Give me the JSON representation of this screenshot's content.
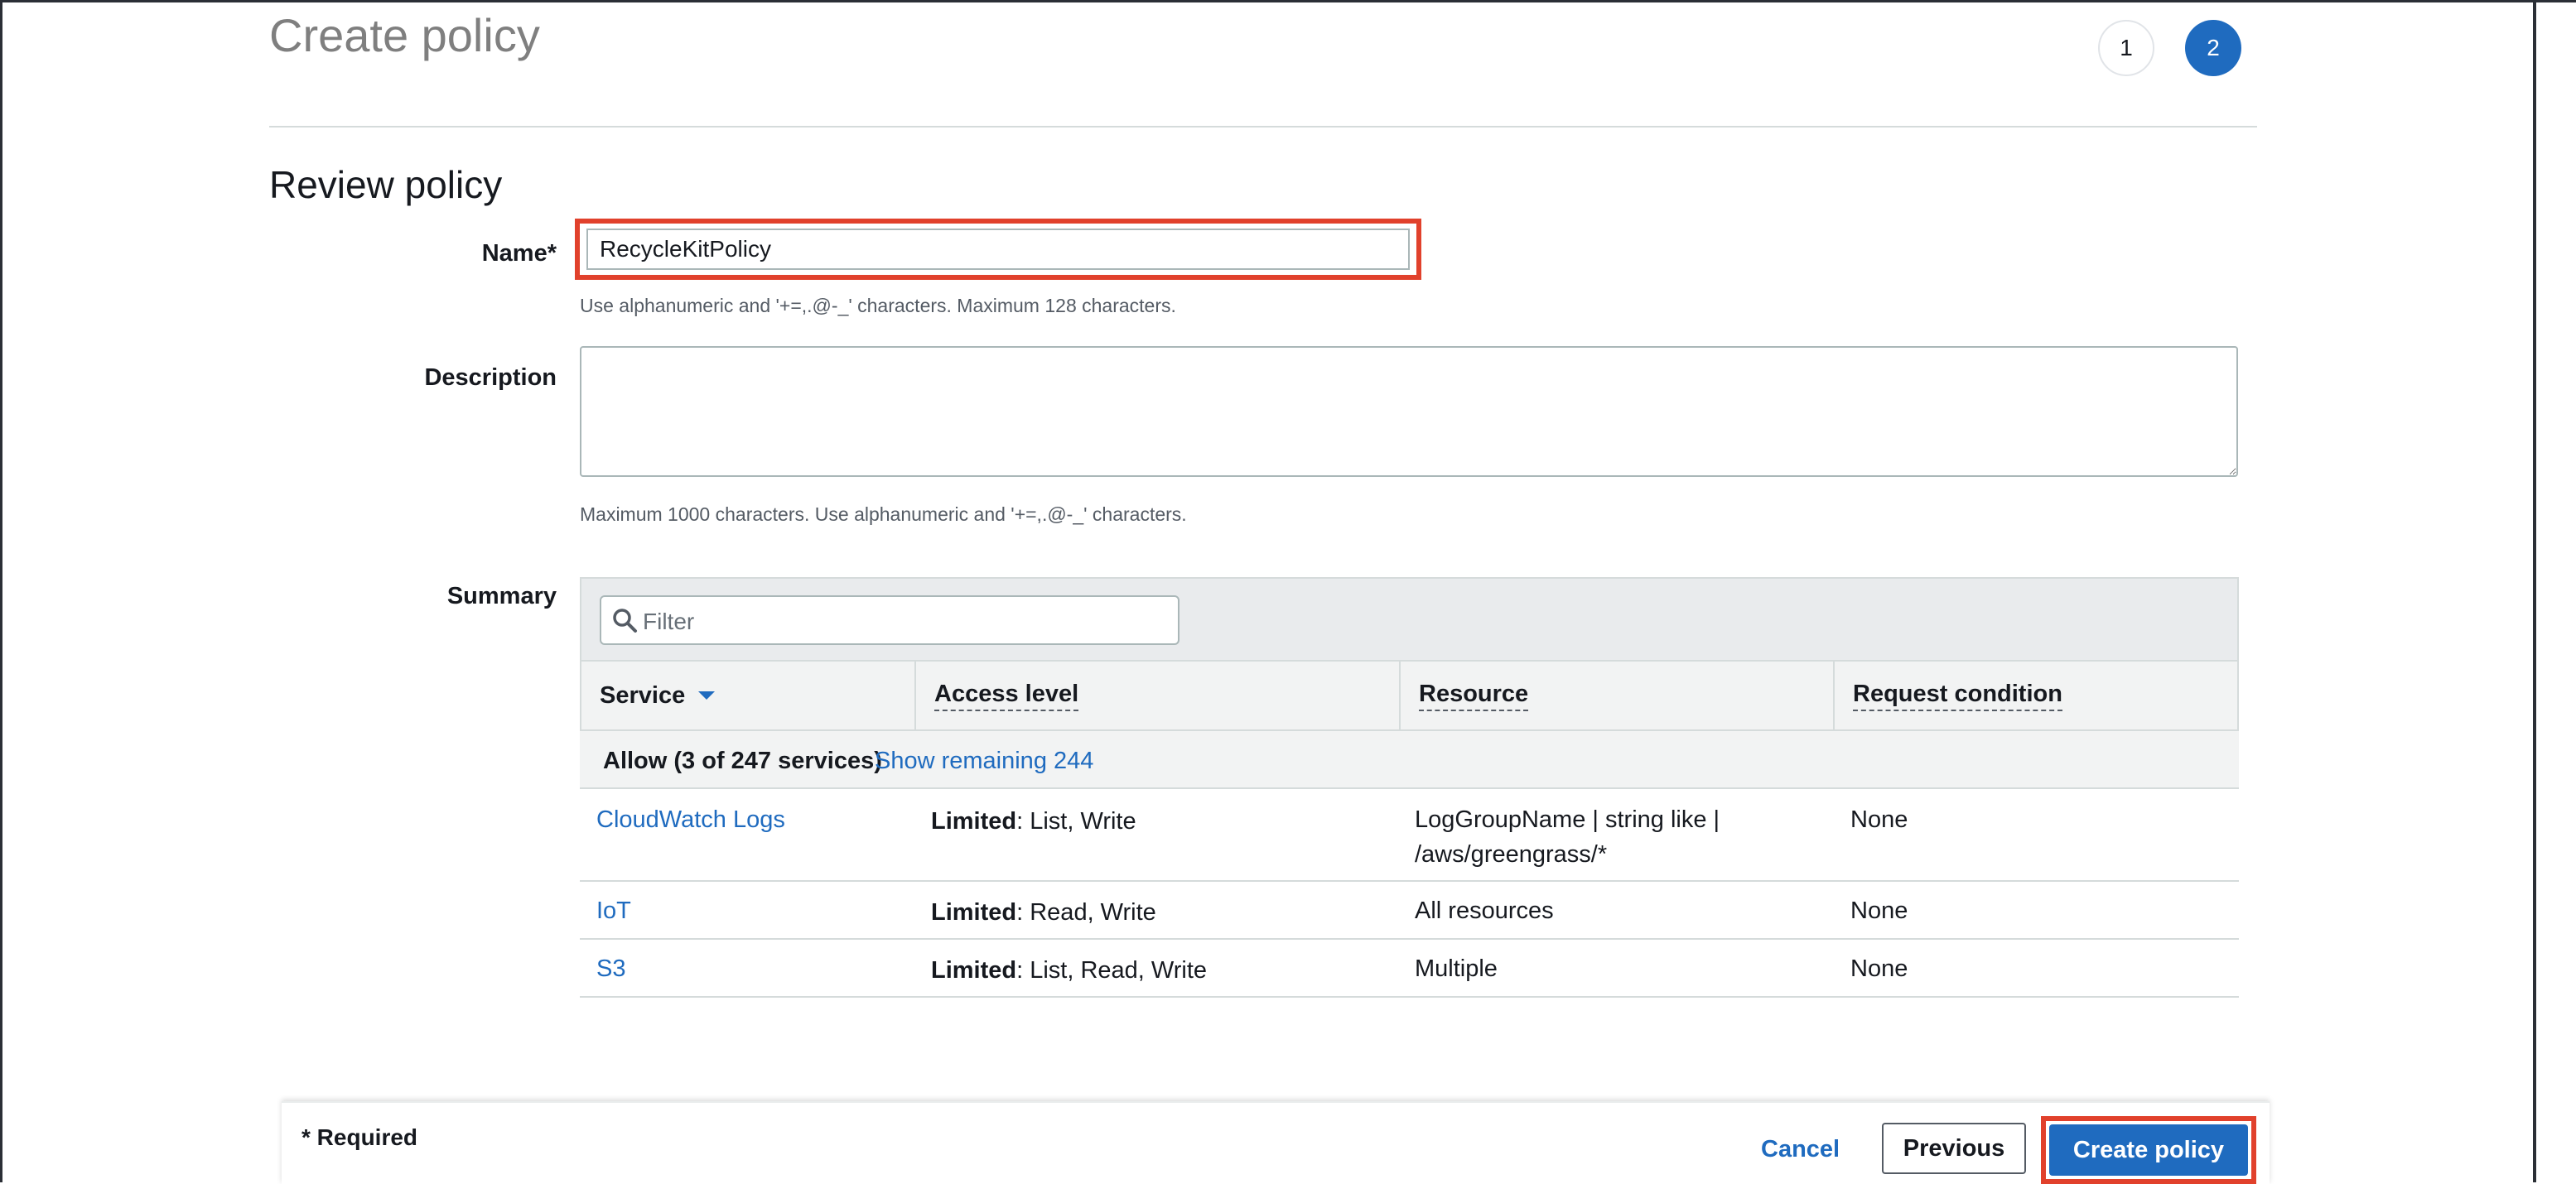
{
  "header": {
    "title": "Create policy",
    "steps": [
      "1",
      "2"
    ]
  },
  "section_title": "Review policy",
  "form": {
    "name_label": "Name*",
    "name_value": "RecycleKitPolicy",
    "name_hint": "Use alphanumeric and '+=,.@-_' characters. Maximum 128 characters.",
    "description_label": "Description",
    "description_value": "",
    "description_hint": "Maximum 1000 characters. Use alphanumeric and '+=,.@-_' characters.",
    "summary_label": "Summary"
  },
  "summary": {
    "filter_placeholder": "Filter",
    "columns": [
      "Service",
      "Access level",
      "Resource",
      "Request condition"
    ],
    "group": {
      "label": "Allow (3 of 247 services)",
      "link": "Show remaining 244"
    },
    "rows": [
      {
        "service": "CloudWatch Logs",
        "access_bold": "Limited",
        "access_rest": ": List, Write",
        "resource_line1": "LogGroupName | string like |",
        "resource_line2": "/aws/greengrass/*",
        "condition": "None"
      },
      {
        "service": "IoT",
        "access_bold": "Limited",
        "access_rest": ": Read, Write",
        "resource_line1": "All resources",
        "resource_line2": "",
        "condition": "None"
      },
      {
        "service": "S3",
        "access_bold": "Limited",
        "access_rest": ": List, Read, Write",
        "resource_line1": "Multiple",
        "resource_line2": "",
        "condition": "None"
      }
    ]
  },
  "footer": {
    "required_note": "* Required",
    "cancel_label": "Cancel",
    "previous_label": "Previous",
    "create_label": "Create policy"
  },
  "colors": {
    "accent": "#1f6bbf",
    "highlight": "#e1412c"
  }
}
